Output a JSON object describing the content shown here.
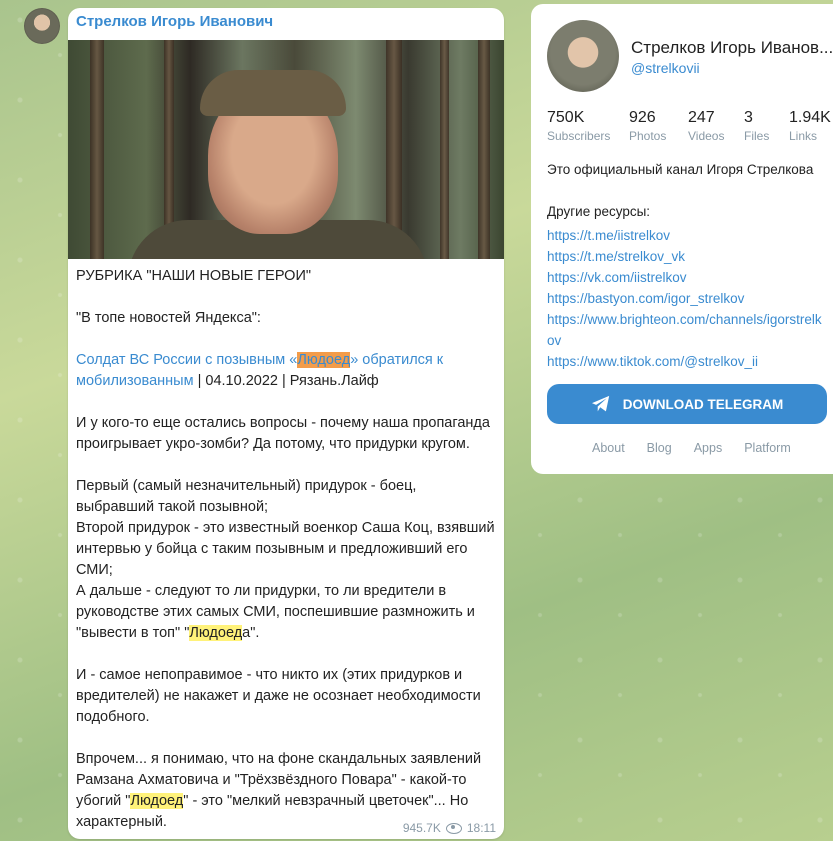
{
  "post": {
    "author": "Стрелков Игорь Иванович",
    "rubric": "РУБРИКА \"НАШИ НОВЫЕ ГЕРОИ\"",
    "intro": "\"В топе новостей Яндекса\":",
    "headline_part1": "Солдат ВС России с позывным «",
    "headline_highlight": "Людоед",
    "headline_part2": "» обратился к мобилизованным",
    "headline_meta": " | 04.10.2022 | Рязань.Лайф",
    "para1": "И у кого-то еще остались вопросы - почему наша пропаганда проигрывает укро-зомби? Да потому, что придурки кругом.",
    "para2_line1": "Первый (самый незначительный) придурок - боец, выбравший такой позывной;",
    "para2_line2": "Второй придурок - это известный военкор Саша Коц, взявший интервью у бойца с таким позывным и предложивший его СМИ;",
    "para2_line3_part1": "А дальше - следуют то ли придурки, то ли вредители в руководстве этих самых СМИ, поспешившие размножить и \"вывести в топ\" \"",
    "para2_line3_highlight": "Людоед",
    "para2_line3_part2": "а\".",
    "para3": "И - самое непоправимое - что никто их (этих придурков и вредителей) не накажет и даже не осознает необходимости подобного.",
    "para4_part1": "Впрочем... я понимаю, что на фоне скандальных заявлений Рамзана Ахматовича и \"Трёхзвёздного Повара\" - какой-то убогий \"",
    "para4_highlight": "Людоед",
    "para4_part2": "\" - это \"мелкий невзрачный цветочек\"... Но характерный.",
    "views": "945.7K",
    "time": "18:11"
  },
  "channel": {
    "name": "Стрелков Игорь Иванов...",
    "username": "@strelkovii",
    "stats": [
      {
        "num": "750K",
        "label": "Subscribers"
      },
      {
        "num": "926",
        "label": "Photos"
      },
      {
        "num": "247",
        "label": "Videos"
      },
      {
        "num": "3",
        "label": "Files"
      },
      {
        "num": "1.94K",
        "label": "Links"
      }
    ],
    "description": "Это официальный канал Игоря Стрелкова",
    "resources_title": "Другие ресурсы:",
    "resources": [
      "https://t.me/iistrelkov",
      "https://t.me/strelkov_vk",
      "https://vk.com/iistrelkov",
      "https://bastyon.com/igor_strelkov",
      "https://www.brighteon.com/channels/igorstrelkov",
      "https://www.tiktok.com/@strelkov_ii"
    ],
    "download_label": "DOWNLOAD TELEGRAM",
    "footer": [
      "About",
      "Blog",
      "Apps",
      "Platform"
    ]
  },
  "colors": {
    "accent": "#3a8bd0",
    "highlight": "#fff27a",
    "highlight_active": "#f39c4a"
  },
  "icons": [
    "eye-icon",
    "paper-plane-icon"
  ]
}
